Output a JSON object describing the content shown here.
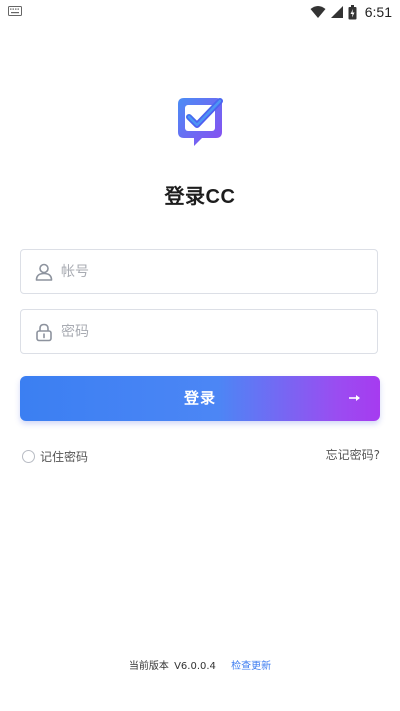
{
  "status_bar": {
    "time": "6:51",
    "icons": [
      "keyboard-icon",
      "wifi-icon",
      "signal-icon",
      "battery-icon"
    ]
  },
  "app": {
    "title": "登录CC",
    "logo_icon": "chat-check-icon"
  },
  "form": {
    "account": {
      "placeholder": "帐号",
      "value": "",
      "icon": "user-icon"
    },
    "password": {
      "placeholder": "密码",
      "value": "",
      "icon": "lock-icon"
    },
    "login_label": "登录",
    "remember_label": "记住密码",
    "remember_checked": false,
    "forgot_label": "忘记密码?"
  },
  "footer": {
    "version_label": "当前版本",
    "version_value": "V6.0.0.4",
    "check_update": "检查更新"
  },
  "colors": {
    "accent": "#3d7cf0",
    "gradient_start": "#3b7ff2",
    "gradient_end": "#a63bf0",
    "border": "#dcdfe6"
  }
}
